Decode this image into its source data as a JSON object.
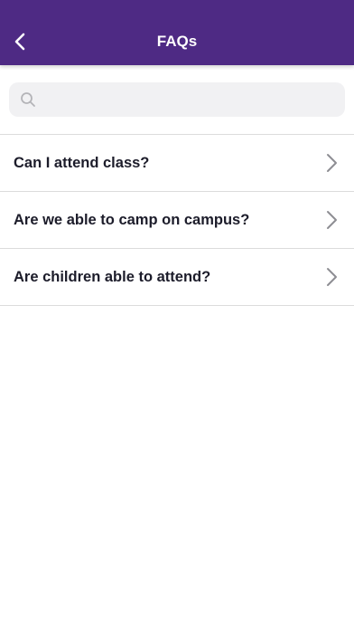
{
  "header": {
    "title": "FAQs",
    "back_icon": "chevron-left-icon",
    "background_color": "#4e2a84"
  },
  "search": {
    "placeholder": "",
    "value": "",
    "icon": "search-icon"
  },
  "faqs": [
    {
      "question": "Can I attend class?",
      "icon": "chevron-right-icon"
    },
    {
      "question": "Are we able to camp on campus?",
      "icon": "chevron-right-icon"
    },
    {
      "question": "Are children able to attend?",
      "icon": "chevron-right-icon"
    }
  ]
}
